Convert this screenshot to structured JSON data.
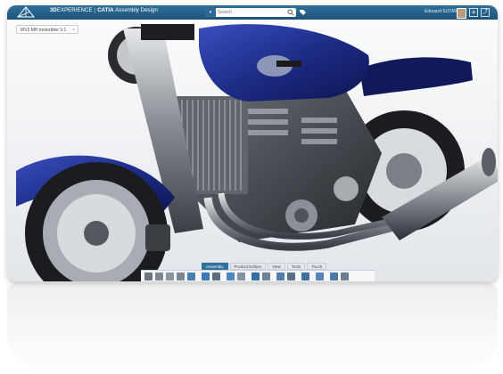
{
  "app": {
    "brand_prefix": "3D",
    "brand_name": "EXPERIENCE",
    "product": "CATIA",
    "module": "Assembly Design"
  },
  "search": {
    "scope_tag": "▾",
    "placeholder": "Search"
  },
  "user": {
    "name": "Edouard SUTAR"
  },
  "document_tab": {
    "label": "MV2 MH motorbike V.1",
    "close": "×"
  },
  "toolbar_tabs": [
    {
      "label": "Assembly",
      "active": true
    },
    {
      "label": "Product Edition",
      "active": false
    },
    {
      "label": "View",
      "active": false
    },
    {
      "label": "Tools",
      "active": false
    },
    {
      "label": "Touch",
      "active": false
    }
  ],
  "tools": [
    "cut-icon",
    "copy-icon",
    "paste-icon",
    "delete-icon",
    "undo-icon",
    "insert-product-icon",
    "replace-icon",
    "explode-icon",
    "measure-icon",
    "section-icon",
    "sweep-icon",
    "clash-icon",
    "constraint-icon",
    "fix-icon",
    "zoom-icon",
    "align-icon",
    "group-icon"
  ],
  "colors": {
    "top_bar": "#1d5479",
    "tank_blue": "#1d2c86",
    "active_tab": "#2f6f9a"
  }
}
